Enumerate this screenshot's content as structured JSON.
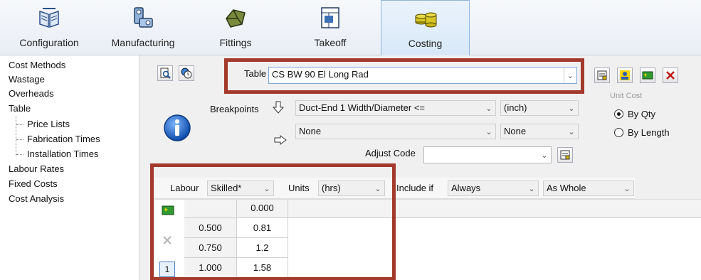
{
  "ribbon": {
    "tabs": [
      {
        "label": "Configuration",
        "icon": "book-icon"
      },
      {
        "label": "Manufacturing",
        "icon": "machine-icon"
      },
      {
        "label": "Fittings",
        "icon": "fitting-icon"
      },
      {
        "label": "Takeoff",
        "icon": "takeoff-icon"
      },
      {
        "label": "Costing",
        "icon": "coins-icon",
        "active": true
      }
    ]
  },
  "nav": {
    "items": [
      {
        "label": "Cost Methods"
      },
      {
        "label": "Wastage"
      },
      {
        "label": "Overheads"
      },
      {
        "label": "Table"
      },
      {
        "label": "Price Lists"
      },
      {
        "label": "Fabrication Times"
      },
      {
        "label": "Installation Times"
      },
      {
        "label": "Labour Rates"
      },
      {
        "label": "Fixed Costs"
      },
      {
        "label": "Cost Analysis"
      }
    ]
  },
  "table_section": {
    "label": "Table",
    "value": "CS BW 90 El Long Rad"
  },
  "breakpoints": {
    "label": "Breakpoints",
    "row1_value": "Duct-End 1 Width/Diameter <=",
    "row1_unit": "(inch)",
    "row2_value": "None",
    "row2_unit": "None"
  },
  "adjust_code": {
    "label": "Adjust Code",
    "value": ""
  },
  "unit_cost": {
    "label": "Unit Cost",
    "options": [
      {
        "label": "By Qty",
        "selected": true
      },
      {
        "label": "By Length",
        "selected": false
      }
    ]
  },
  "grid_bar": {
    "labour_label": "Labour",
    "labour_value": "Skilled*",
    "units_label": "Units",
    "units_value": "(hrs)",
    "include_label": "Include if",
    "include_value": "Always",
    "whole_value": "As Whole"
  },
  "grid": {
    "column_header": "0.000",
    "rows": [
      {
        "key": "0.500",
        "value": "0.81"
      },
      {
        "key": "0.750",
        "value": "1.2"
      },
      {
        "key": "1.000",
        "value": "1.58"
      }
    ],
    "row_indicator": "1"
  }
}
